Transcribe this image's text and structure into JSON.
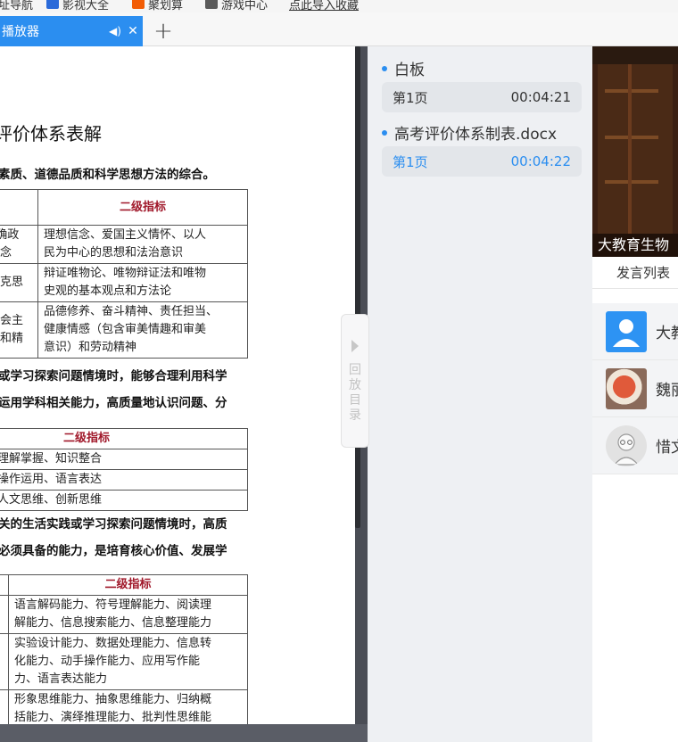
{
  "bookmarks": [
    {
      "label": "址导航",
      "icon": "home-icon",
      "color": "#3a7bd5"
    },
    {
      "label": "影视大全",
      "icon": "film-icon",
      "color": "#2a6ad9"
    },
    {
      "label": "聚划算",
      "icon": "shopping-icon",
      "color": "#f25c05"
    },
    {
      "label": "游戏中心",
      "icon": "gamepad-icon",
      "color": "#5a5a5a"
    },
    {
      "label": "点此导入收藏",
      "icon": "import-icon",
      "color": "#333333"
    }
  ],
  "tab": {
    "title": "播放器",
    "audio_icon": "speaker-icon",
    "close_label": "✕"
  },
  "new_tab_label": "+",
  "document": {
    "title": "评价体系表解",
    "line1": "素质、道德品质和科学思想方法的综合。",
    "table1": {
      "header": "二级指标",
      "rows": [
        {
          "left": "E确政\n观念",
          "right": "理想信念、爱国主义情怀、以人\n民为中心的思想和法治意识"
        },
        {
          "left": "马克思",
          "right": "辩证唯物论、唯物辩证法和唯物\n史观的基本观点和方法论"
        },
        {
          "left": "社会主\n德和精",
          "right": "品德修养、奋斗精神、责任担当、\n健康情感（包含审美情趣和审美\n意识）和劳动精神"
        }
      ]
    },
    "line2": "或学习探索问题情境时，能够合理利用科学",
    "line3": "运用学科相关能力，高质量地认识问题、分",
    "table2": {
      "header": "二级指标",
      "rows": [
        "理解掌握、知识整合",
        "操作运用、语言表达",
        "人文思维、创新思维"
      ]
    },
    "line4": "关的生活实践或学习探索问题情境时，高质",
    "line5": "必须具备的能力，是培育核心价值、发展学",
    "table3": {
      "header": "二级指标",
      "rows": [
        "语言解码能力、符号理解能力、阅读理\n解能力、信息搜索能力、信息整理能力",
        "实验设计能力、数据处理能力、信息转\n化能力、动手操作能力、应用写作能\n力、语言表达能力",
        "形象思维能力、抽象思维能力、归纳概\n括能力、演绎推理能力、批判性思维能"
      ]
    }
  },
  "replay_directory": {
    "label": "回放目录"
  },
  "playlist": [
    {
      "title": "白板",
      "page": "第1页",
      "time": "00:04:21",
      "active": false
    },
    {
      "title": "高考评价体系制表.docx",
      "page": "第1页",
      "time": "00:04:22",
      "active": true
    }
  ],
  "video": {
    "caption": "大教育生物"
  },
  "speaker_list_label": "发言列表",
  "speakers": [
    {
      "name": "大教",
      "avatar": "default-user-icon"
    },
    {
      "name": "魏丽",
      "avatar": "photo-avatar"
    },
    {
      "name": "惜文",
      "avatar": "cartoon-avatar"
    }
  ]
}
